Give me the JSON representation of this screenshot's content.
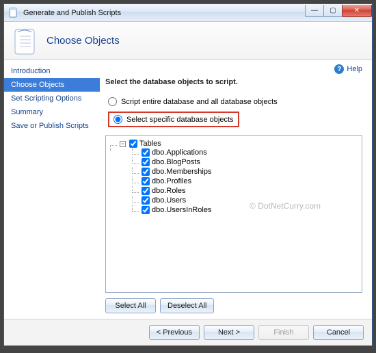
{
  "window": {
    "title": "Generate and Publish Scripts"
  },
  "header": {
    "title": "Choose Objects"
  },
  "help": {
    "label": "Help"
  },
  "sidebar": {
    "items": [
      {
        "label": "Introduction",
        "active": false
      },
      {
        "label": "Choose Objects",
        "active": true
      },
      {
        "label": "Set Scripting Options",
        "active": false
      },
      {
        "label": "Summary",
        "active": false
      },
      {
        "label": "Save or Publish Scripts",
        "active": false
      }
    ]
  },
  "main": {
    "instruction": "Select the database objects to script.",
    "radio1": "Script entire database and all database objects",
    "radio2": "Select specific database objects",
    "tree_root": "Tables",
    "tree_items": [
      "dbo.Applications",
      "dbo.BlogPosts",
      "dbo.Memberships",
      "dbo.Profiles",
      "dbo.Roles",
      "dbo.Users",
      "dbo.UsersInRoles"
    ],
    "watermark": "© DotNetCurry.com",
    "select_all": "Select All",
    "deselect_all": "Deselect All"
  },
  "footer": {
    "previous": "< Previous",
    "next": "Next >",
    "finish": "Finish",
    "cancel": "Cancel"
  }
}
